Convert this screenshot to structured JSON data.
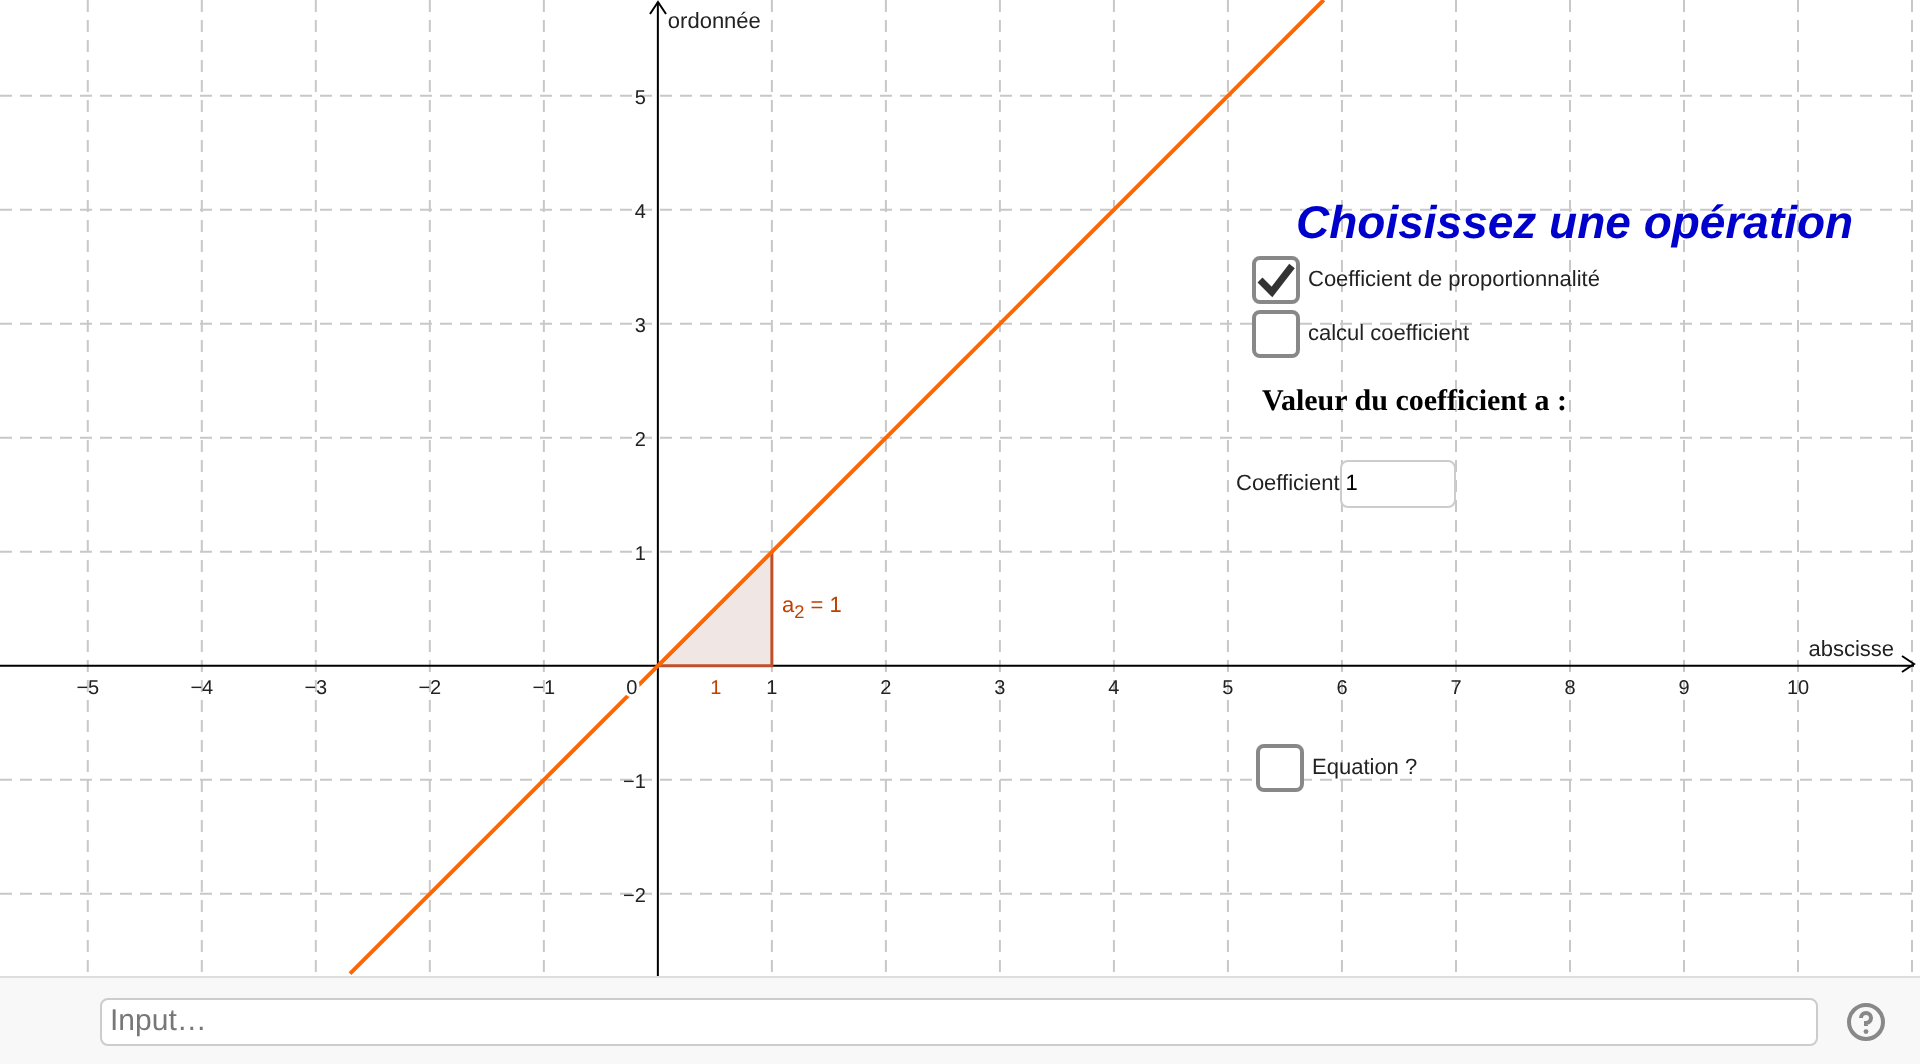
{
  "graphics": {
    "chart_data": {
      "type": "line",
      "xlabel": "abscisse",
      "ylabel": "ordonnée",
      "x": [
        -2.7,
        5.84
      ],
      "series": [
        {
          "color": "#ff6600",
          "values": [
            -2.7,
            5.84
          ]
        }
      ],
      "grid": true,
      "xlim": [
        -5.77,
        11.07
      ],
      "ylim": [
        -2.72,
        5.84
      ],
      "xticks": [
        {
          "value": -5,
          "label": "−5"
        },
        {
          "value": -4,
          "label": "−4"
        },
        {
          "value": -3,
          "label": "−3"
        },
        {
          "value": -2,
          "label": "−2"
        },
        {
          "value": -1,
          "label": "−1"
        },
        1,
        2,
        3,
        4,
        5,
        6,
        7,
        8,
        9,
        10
      ],
      "yticks": [
        {
          "value": -2,
          "label": "−2"
        },
        {
          "value": -1,
          "label": "−1"
        },
        1,
        2,
        3,
        4,
        5
      ]
    },
    "origin_label": "0",
    "slope": {
      "run_label": "1",
      "rise_label": "a$_{2}$ = 1"
    }
  },
  "panel": {
    "title": "Choisissez une opération",
    "checkboxes": [
      {
        "label": "Coefficient de proportionnalité",
        "checked": true
      },
      {
        "label": "calcul coefficient",
        "checked": false
      }
    ],
    "heading": "Valeur du coefficient a :",
    "field": {
      "label": "Coefficient",
      "value": "1"
    }
  },
  "equation_checkbox": {
    "label": "Equation ?",
    "checked": false
  },
  "input_bar": {
    "placeholder": "Input…"
  }
}
